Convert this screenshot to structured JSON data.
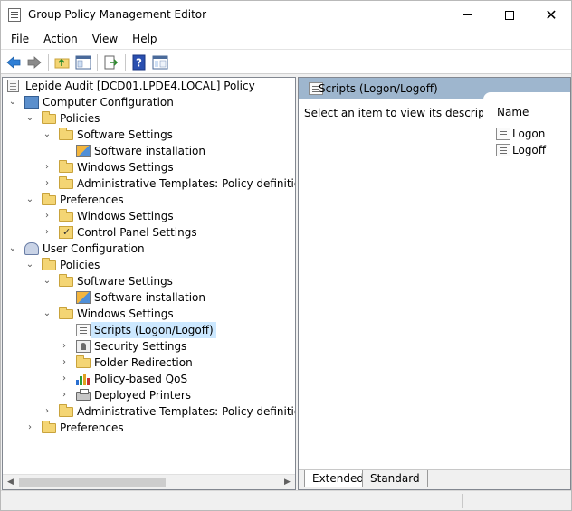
{
  "window": {
    "title": "Group Policy Management Editor"
  },
  "menu": [
    "File",
    "Action",
    "View",
    "Help"
  ],
  "toolbar": {
    "icons": [
      "back-arrow-icon",
      "forward-arrow-icon",
      "up-folder-icon",
      "show-hide-tree-icon",
      "export-list-icon",
      "help-icon",
      "properties-icon"
    ]
  },
  "tree": {
    "root": "Lepide Audit [DCD01.LPDE4.LOCAL] Policy",
    "computer_config": "Computer Configuration",
    "cc_policies": "Policies",
    "cc_software_settings": "Software Settings",
    "cc_software_installation": "Software installation",
    "cc_windows_settings": "Windows Settings",
    "cc_admin_templates": "Administrative Templates: Policy definitions (ADMX files) retrieved from the local computer.",
    "cc_preferences": "Preferences",
    "cc_pref_windows_settings": "Windows Settings",
    "cc_control_panel": "Control Panel Settings",
    "user_config": "User Configuration",
    "uc_policies": "Policies",
    "uc_software_settings": "Software Settings",
    "uc_software_installation": "Software installation",
    "uc_windows_settings": "Windows Settings",
    "uc_scripts": "Scripts (Logon/Logoff)",
    "uc_security_settings": "Security Settings",
    "uc_folder_redirection": "Folder Redirection",
    "uc_policy_qos": "Policy-based QoS",
    "uc_deployed_printers": "Deployed Printers",
    "uc_admin_templates": "Administrative Templates: Policy definitions (ADMX files) retrieved from the local computer.",
    "uc_preferences": "Preferences"
  },
  "right": {
    "header": "Scripts (Logon/Logoff)",
    "description": "Select an item to view its description.",
    "column": "Name",
    "items": [
      "Logon",
      "Logoff"
    ]
  },
  "tabs": {
    "extended": "Extended",
    "standard": "Standard"
  },
  "colors": {
    "header_bg": "#9eb6ce",
    "selection": "#cce8ff",
    "folder": "#f4d574"
  }
}
